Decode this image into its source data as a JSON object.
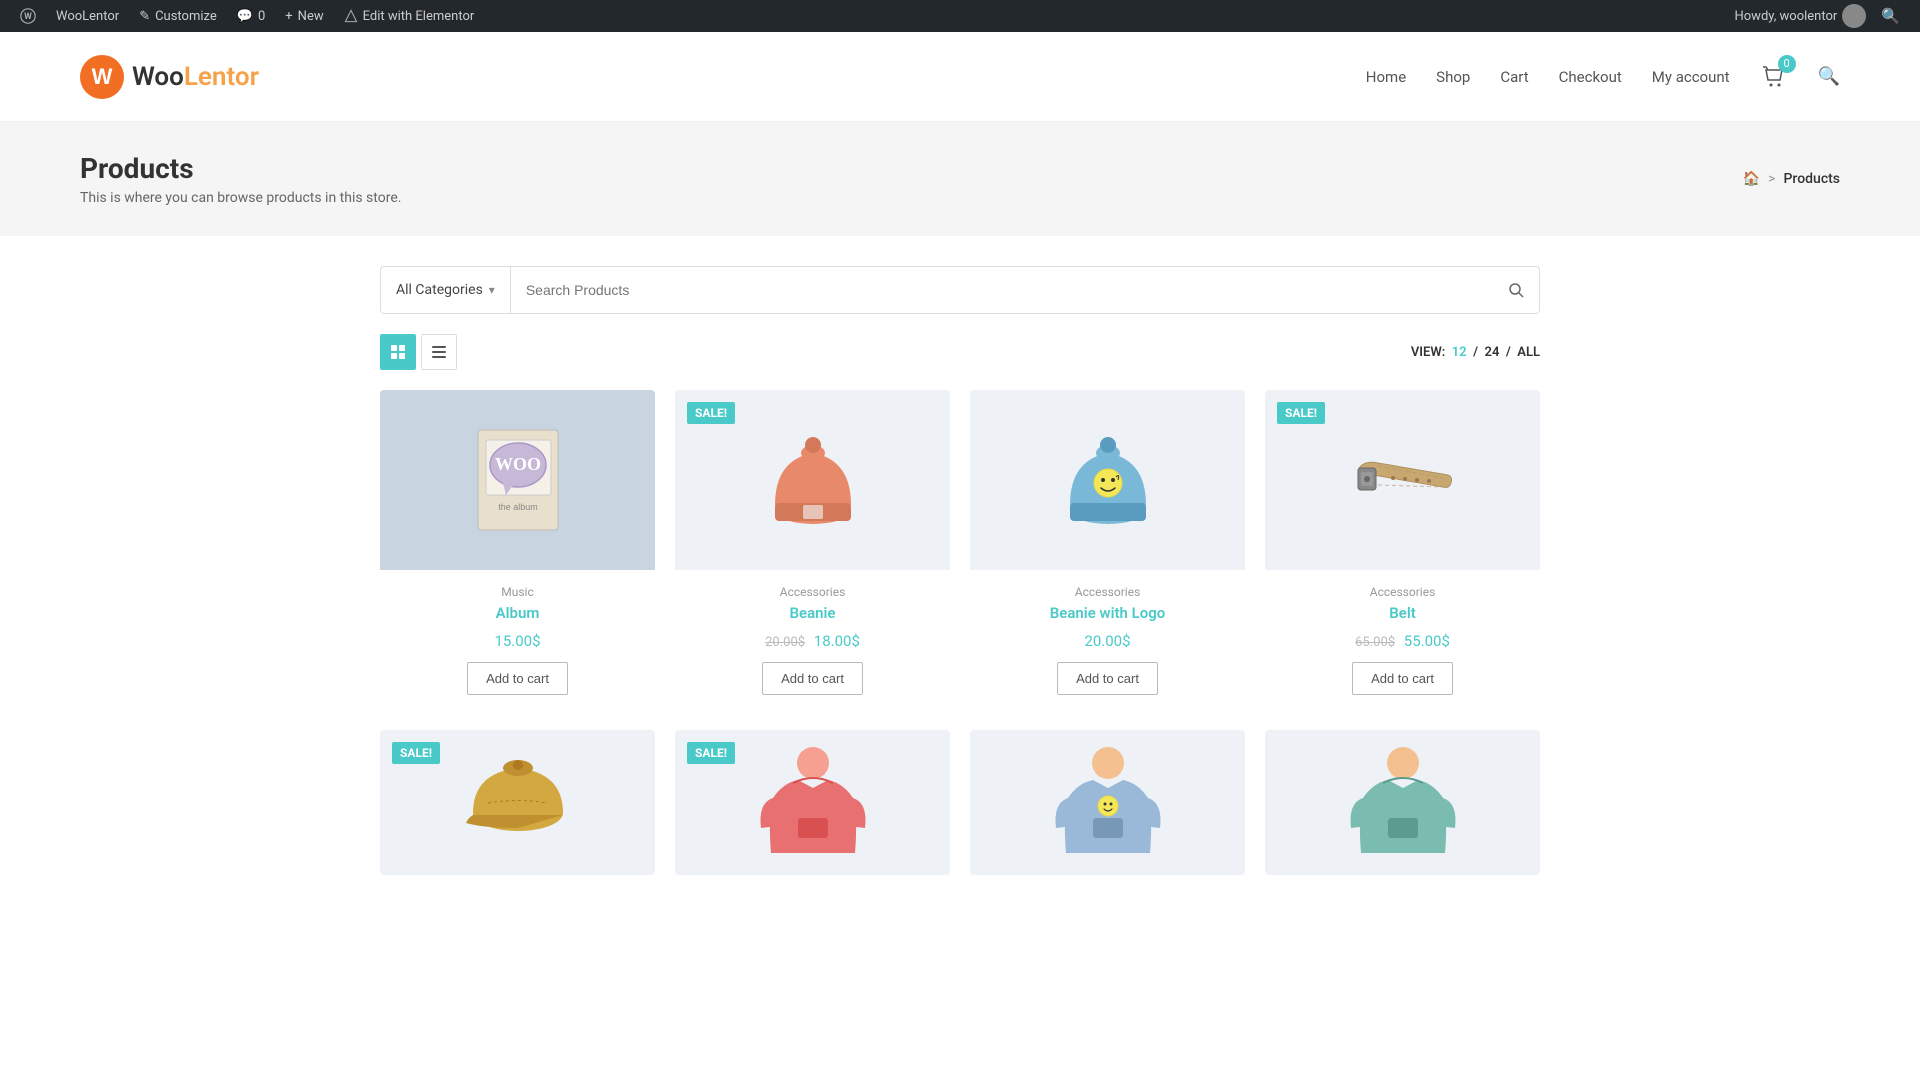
{
  "adminBar": {
    "items": [
      {
        "id": "wp-logo",
        "label": "",
        "icon": "⊞"
      },
      {
        "id": "woolentor",
        "label": "WooLentor",
        "icon": ""
      },
      {
        "id": "customize",
        "label": "Customize",
        "icon": "✎"
      },
      {
        "id": "comments",
        "label": "0",
        "icon": "💬"
      },
      {
        "id": "new",
        "label": "New",
        "icon": "+"
      },
      {
        "id": "edit-elementor",
        "label": "Edit with Elementor",
        "icon": "⬡"
      }
    ],
    "right": {
      "howdy": "Howdy, woolentor",
      "searchIcon": "🔍"
    }
  },
  "header": {
    "logoText1": "Woo",
    "logoText2": "Lentor",
    "nav": {
      "links": [
        "Home",
        "Shop",
        "Cart",
        "Checkout",
        "My account"
      ],
      "cartCount": "0"
    }
  },
  "pageHero": {
    "title": "Products",
    "subtitle": "This is where you can browse products in this store.",
    "breadcrumb": {
      "home": "🏠",
      "sep": ">",
      "current": "Products"
    }
  },
  "search": {
    "category": "All Categories",
    "placeholder": "Search Products"
  },
  "viewControls": {
    "gridLabel": "⊞",
    "listLabel": "≡",
    "viewPrefix": "VIEW:",
    "counts": [
      "12",
      "24",
      "ALL"
    ]
  },
  "products": [
    {
      "id": "album",
      "category": "Music",
      "name": "Album",
      "price": "15.00$",
      "oldPrice": null,
      "sale": false,
      "color": "#c8d4e0",
      "type": "album"
    },
    {
      "id": "beanie",
      "category": "Accessories",
      "name": "Beanie",
      "price": "18.00$",
      "oldPrice": "20.00$",
      "sale": true,
      "color": "#eef2f7",
      "type": "beanie-orange"
    },
    {
      "id": "beanie-logo",
      "category": "Accessories",
      "name": "Beanie with Logo",
      "price": "20.00$",
      "oldPrice": null,
      "sale": false,
      "color": "#eef2f7",
      "type": "beanie-blue"
    },
    {
      "id": "belt",
      "category": "Accessories",
      "name": "Belt",
      "price": "55.00$",
      "oldPrice": "65.00$",
      "sale": true,
      "color": "#eef2f7",
      "type": "belt"
    }
  ],
  "bottomProducts": [
    {
      "id": "cap",
      "sale": true,
      "color": "#eef2f7",
      "type": "cap"
    },
    {
      "id": "hoodie-red",
      "sale": true,
      "color": "#eef2f7",
      "type": "hoodie-red"
    },
    {
      "id": "hoodie-blue",
      "sale": false,
      "color": "#eef2f7",
      "type": "hoodie-blue"
    },
    {
      "id": "hoodie-green",
      "sale": false,
      "color": "#eef2f7",
      "type": "hoodie-green"
    }
  ],
  "saleBadge": "SALE!",
  "addToCart": "Add to cart"
}
